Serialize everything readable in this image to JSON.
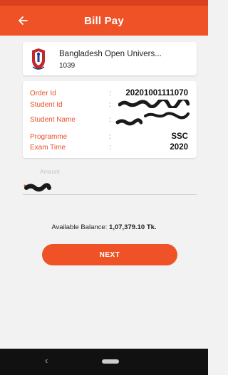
{
  "appbar": {
    "title": "Bill Pay",
    "back_icon": "arrow-left-icon"
  },
  "organization": {
    "name": "Bangladesh Open Univers...",
    "code": "1039",
    "logo_icon": "university-crest-icon"
  },
  "details": {
    "order_id_label": "Order Id",
    "order_id_value": "20201001111070",
    "student_id_label": "Student Id",
    "student_name_label": "Student Name",
    "programme_label": "Programme",
    "programme_value": "SSC",
    "exam_time_label": "Exam Time",
    "exam_time_value": "2020",
    "separator": ":"
  },
  "amount": {
    "label": "Amount"
  },
  "balance": {
    "label": "Available Balance:",
    "value": "1,07,379.10 Tk."
  },
  "next_button": {
    "label": "NEXT"
  },
  "colors": {
    "accent": "#f05228",
    "label": "#e8502c",
    "navbar": "#111111"
  }
}
